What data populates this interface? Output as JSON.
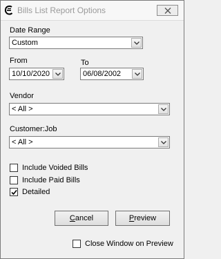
{
  "window": {
    "title": "Bills List Report Options"
  },
  "date_range": {
    "label": "Date Range",
    "value": "Custom"
  },
  "from": {
    "label": "From",
    "value": "10/10/2020"
  },
  "to": {
    "label": "To",
    "value": "06/08/2002"
  },
  "vendor": {
    "label": "Vendor",
    "value": "< All >"
  },
  "customer_job": {
    "label": "Customer:Job",
    "value": "< All >"
  },
  "options": {
    "include_voided": {
      "label": "Include Voided Bills",
      "checked": false
    },
    "include_paid": {
      "label": "Include Paid Bills",
      "checked": false
    },
    "detailed": {
      "label": "Detailed",
      "checked": true
    }
  },
  "buttons": {
    "cancel_accel": "C",
    "cancel_rest": "ancel",
    "preview_accel": "P",
    "preview_rest": "review"
  },
  "close_on_preview": {
    "label": "Close Window on Preview",
    "checked": false
  }
}
